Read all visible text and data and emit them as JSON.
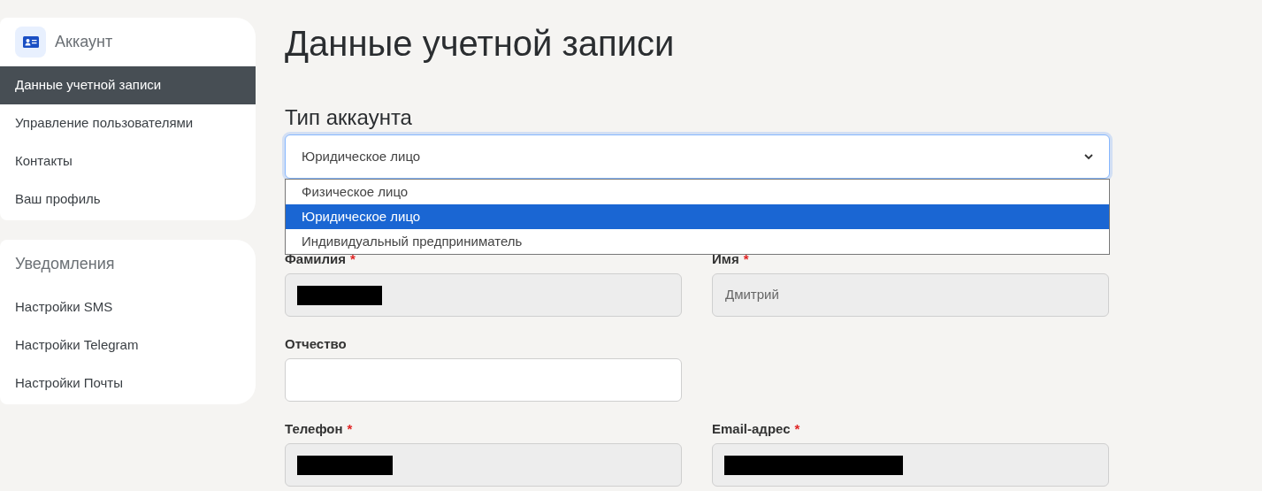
{
  "sidebar": {
    "sections": [
      {
        "title": "Аккаунт",
        "items": [
          {
            "label": "Данные учетной записи",
            "selected": true
          },
          {
            "label": "Управление пользователями",
            "selected": false
          },
          {
            "label": "Контакты",
            "selected": false
          },
          {
            "label": "Ваш профиль",
            "selected": false
          }
        ]
      },
      {
        "title": "Уведомления",
        "items": [
          {
            "label": "Настройки SMS",
            "selected": false
          },
          {
            "label": "Настройки Telegram",
            "selected": false
          },
          {
            "label": "Настройки Почты",
            "selected": false
          }
        ]
      }
    ]
  },
  "page_title": "Данные учетной записи",
  "account_type": {
    "label": "Тип аккаунта",
    "value": "Юридическое лицо",
    "expanded": true,
    "options": [
      {
        "label": "Физическое лицо",
        "selected": false
      },
      {
        "label": "Юридическое лицо",
        "selected": true
      },
      {
        "label": "Индивидуальный предприниматель",
        "selected": false
      }
    ]
  },
  "fields": [
    {
      "label": "Фамилия",
      "marker": "*",
      "disabled": true,
      "redacted": true
    },
    {
      "label": "Имя",
      "marker": "*",
      "disabled": true,
      "value": "Дмитрий"
    },
    {
      "label": "Отчество",
      "disabled": false
    },
    {
      "kind": "spacer"
    },
    {
      "label": "Телефон",
      "marker": "*",
      "disabled": true,
      "redacted": true
    },
    {
      "label": "Email-адрес",
      "marker": "*",
      "disabled": true,
      "redacted": true
    }
  ]
}
